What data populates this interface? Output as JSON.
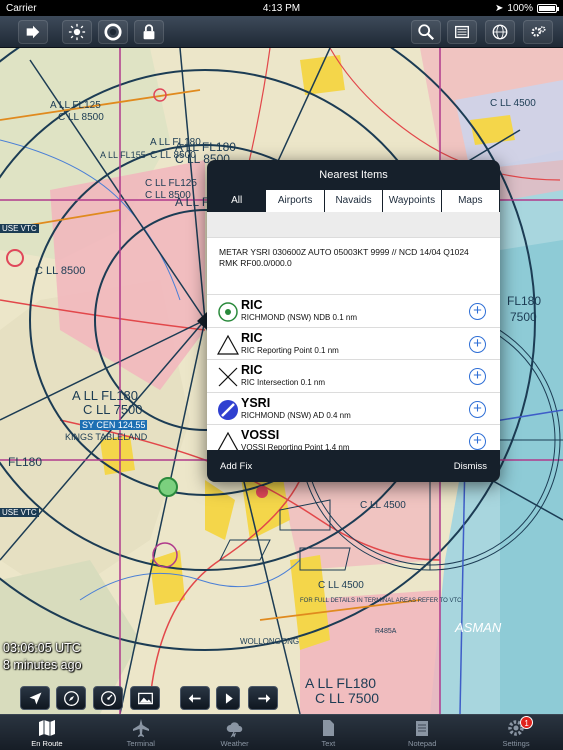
{
  "status_bar": {
    "carrier": "Carrier",
    "time": "4:13 PM",
    "battery": "100%"
  },
  "top_toolbar": {
    "left_buttons": [
      "sidebar-toggle-icon",
      "brightness-icon",
      "lifebuoy-icon",
      "lock-icon"
    ],
    "right_buttons": [
      "search-icon",
      "layers-icon",
      "globe-icon",
      "settings-icon"
    ]
  },
  "map": {
    "labels": [
      "A LL FL180",
      "C LL 8500",
      "A LL FL155",
      "C LL 7500",
      "FL180",
      "7500",
      "A LL FL180",
      "C LL 7500",
      "SY CEN 124.55",
      "KINGS TABLELAND",
      "C LL 4500",
      "C LL 4500",
      "C LL 4500",
      "C LL 4500",
      "C LL 4500",
      "C LL 4500",
      "A LL FL180",
      "C LL 7500",
      "ASMAN",
      "WOLLONGONG",
      "FOR FULL DETAILS IN TERMINAL AREAS REFER TO VTC",
      "USE VTC",
      "USE VTC",
      "C LL FL125",
      "C LL 8500",
      "A LL FL125",
      "C LL 8500",
      "A LL FL180",
      "C LL 8500",
      "A LL FL180",
      "C LL 8500",
      "FL180",
      "R485A"
    ]
  },
  "popover": {
    "title": "Nearest Items",
    "tabs": [
      "All",
      "Airports",
      "Navaids",
      "Waypoints",
      "Maps"
    ],
    "active_tab": "All",
    "metar": "METAR YSRI 030600Z AUTO 05003KT 9999 // NCD 14/04 Q1024 RMK RF00.0/000.0",
    "items": [
      {
        "ident": "RIC",
        "desc": "RICHMOND (NSW) NDB 0.1 nm",
        "icon": "ndb-icon"
      },
      {
        "ident": "RIC",
        "desc": "RIC Reporting Point 0.1 nm",
        "icon": "reporting-point-icon"
      },
      {
        "ident": "RIC",
        "desc": "RIC Intersection 0.1 nm",
        "icon": "intersection-icon"
      },
      {
        "ident": "YSRI",
        "desc": "RICHMOND (NSW) AD 0.4 nm",
        "icon": "aerodrome-icon"
      },
      {
        "ident": "VOSSI",
        "desc": "VOSSI Reporting Point 1.4 nm",
        "icon": "reporting-point-icon"
      }
    ],
    "add_fix_label": "Add Fix",
    "dismiss_label": "Dismiss"
  },
  "utc_overlay": {
    "time": "03:06:05 UTC",
    "age": "8 minutes ago"
  },
  "map_controls": [
    "location-arrow-icon",
    "compass-icon",
    "gauge-icon",
    "image-icon",
    "back-arrow-icon",
    "play-icon",
    "forward-arrow-icon"
  ],
  "tab_bar": {
    "items": [
      {
        "label": "En Route",
        "icon": "map-icon"
      },
      {
        "label": "Terminal",
        "icon": "airplane-icon"
      },
      {
        "label": "Weather",
        "icon": "cloud-icon"
      },
      {
        "label": "Text",
        "icon": "document-icon"
      },
      {
        "label": "Notepad",
        "icon": "notepad-icon"
      },
      {
        "label": "Settings",
        "icon": "gear-icon",
        "badge": "1"
      }
    ],
    "active": "En Route"
  },
  "colors": {
    "accent_blue": "#2f6fd6",
    "toolbar_dark": "#16202b",
    "airspace_red": "#e0475a",
    "sea": "#9ed3dc"
  }
}
